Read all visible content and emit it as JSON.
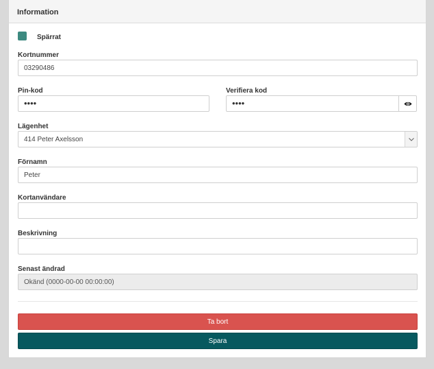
{
  "panel": {
    "title": "Information"
  },
  "blocked": {
    "label": "Spärrat",
    "checked": true,
    "color": "#3d8a80"
  },
  "card_number": {
    "label": "Kortnummer",
    "value": "03290486"
  },
  "pin": {
    "label": "Pin-kod",
    "value": "••••"
  },
  "verify_pin": {
    "label": "Verifiera kod",
    "value": "••••",
    "toggle_icon": "eye-icon"
  },
  "apartment": {
    "label": "Lägenhet",
    "value": "414 Peter Axelsson"
  },
  "first_name": {
    "label": "Förnamn",
    "value": "Peter"
  },
  "card_user": {
    "label": "Kortanvändare",
    "value": ""
  },
  "description": {
    "label": "Beskrivning",
    "value": ""
  },
  "last_changed": {
    "label": "Senast ändrad",
    "value": "Okänd (0000-00-00 00:00:00)"
  },
  "buttons": {
    "delete": "Ta bort",
    "save": "Spara"
  },
  "colors": {
    "delete": "#d9534f",
    "save": "#07595f"
  }
}
